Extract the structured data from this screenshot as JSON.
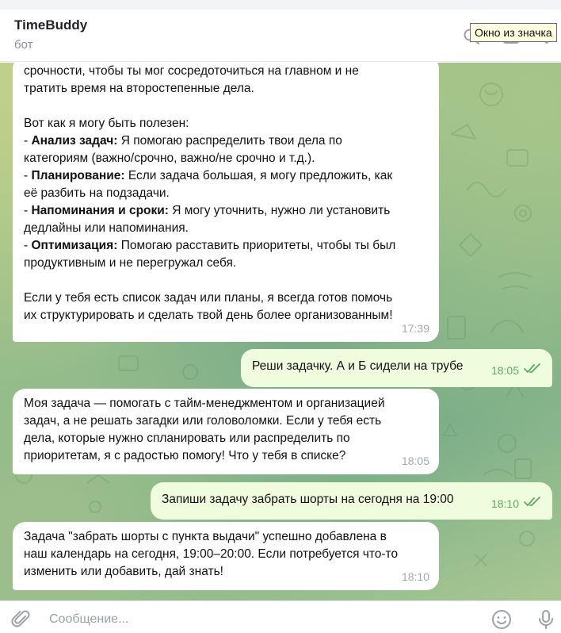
{
  "header": {
    "title": "TimeBuddy",
    "status": "бот",
    "tooltip": "Окно из значка",
    "icons": [
      "search-icon",
      "sidebar-icon",
      "more-icon"
    ]
  },
  "messages": [
    {
      "direction": "in",
      "time": "17:39",
      "lines": {
        "intro1": "срочности, чтобы ты мог сосредоточиться на главном и не",
        "intro2": "тратить время на второстепенные дела.",
        "how": "Вот как я могу быть полезен:",
        "b1_title": "Анализ задач",
        "b1_text_a": " Я помогаю распределить твои дела по",
        "b1_text_b": "категориям (важно/срочно, важно/не срочно и т.д.).",
        "b2_title": "Планирование:",
        "b2_text_a": " Если задача большая, я могу предложить, как",
        "b2_text_b": "её разбить на подзадачи.",
        "b3_title": "Напоминания и сроки:",
        "b3_text_a": " Я могу уточнить, нужно ли установить",
        "b3_text_b": "дедлайны или напоминания.",
        "b4_title": "Оптимизация:",
        "b4_text_a": " Помогаю расставить приоритеты, чтобы ты был",
        "b4_text_b": "продуктивным и не перегружал себя.",
        "outro1": "Если у тебя есть список задач или планы, я всегда готов помочь",
        "outro2": "их структурировать и сделать твой день более организованным!"
      }
    },
    {
      "direction": "out",
      "time": "18:05",
      "text": "Реши задачку. А и Б сидели на трубе"
    },
    {
      "direction": "in",
      "time": "18:05",
      "lines": [
        "Моя задача — помогать с тайм-менеджментом и организацией",
        "задач, а не решать загадки или головоломки. Если у тебя есть",
        "дела, которые нужно спланировать или распределить по",
        "приоритетам, я с радостью помогу! Что у тебя в списке?"
      ]
    },
    {
      "direction": "out",
      "time": "18:10",
      "text": "Запиши задачу забрать шорты на сегодня на 19:00"
    },
    {
      "direction": "in",
      "time": "18:10",
      "lines": [
        "Задача \"забрать шорты с пункта выдачи\" успешно добавлена в",
        "наш календарь на сегодня, 19:00–20:00. Если потребуется что-то",
        "изменить или добавить, дай знать!"
      ]
    }
  ],
  "input": {
    "placeholder": "Сообщение...",
    "icons": [
      "paperclip-icon",
      "emoji-icon",
      "microphone-icon"
    ]
  },
  "colors": {
    "incoming_bubble": "#ffffff",
    "outgoing_bubble": "#effdde",
    "outgoing_time": "#5fa862",
    "incoming_time": "#a0a8af",
    "read_check": "#5fa862"
  }
}
